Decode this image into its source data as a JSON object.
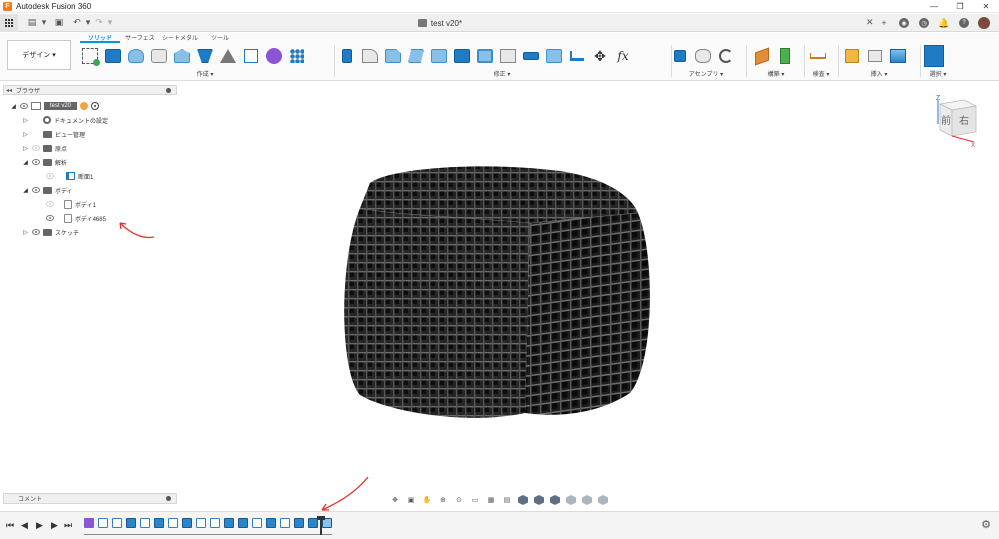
{
  "app": {
    "title": "Autodesk Fusion 360",
    "logo_letter": "F"
  },
  "window_controls": {
    "minimize": "—",
    "restore": "❐",
    "close": "✕"
  },
  "document": {
    "title": "test v20*",
    "close_glyph": "✕"
  },
  "quick_access": {
    "undo": "↶",
    "redo": "↷",
    "dropdown": "▾"
  },
  "workspace": {
    "label": "デザイン ▾"
  },
  "ribbon": {
    "tabs": [
      {
        "label": "ソリッド",
        "active": true
      },
      {
        "label": "サーフェス",
        "active": false
      },
      {
        "label": "シートメタル",
        "active": false
      },
      {
        "label": "ツール",
        "active": false
      }
    ],
    "groups": {
      "create": "作成 ▾",
      "modify": "修正 ▾",
      "assemble": "アセンブリ ▾",
      "construct": "構築 ▾",
      "inspect": "検査 ▾",
      "insert": "挿入 ▾",
      "select": "選択 ▾"
    }
  },
  "browser": {
    "header": "ブラウザ",
    "collapse": "◂◂",
    "items": [
      {
        "label": "test v20"
      },
      {
        "label": "ドキュメントの設定"
      },
      {
        "label": "ビュー管理"
      },
      {
        "label": "原点"
      },
      {
        "label": "解析"
      },
      {
        "label": "断面1"
      },
      {
        "label": "ボディ"
      },
      {
        "label": "ボディ1"
      },
      {
        "label": "ボディ4685"
      },
      {
        "label": "スケッチ"
      }
    ]
  },
  "comment": {
    "label": "コメント"
  },
  "viewcube": {
    "front": "前",
    "right": "右",
    "z_axis": "Z",
    "x_axis": "X"
  },
  "timeline": {
    "first": "⏮",
    "prev": "◀",
    "play": "▶",
    "next": "▶",
    "last": "⏭",
    "settings": "⚙"
  },
  "colors": {
    "accent": "#0696d7",
    "body": "#1b1b1b",
    "annotation": "#e8302a"
  }
}
